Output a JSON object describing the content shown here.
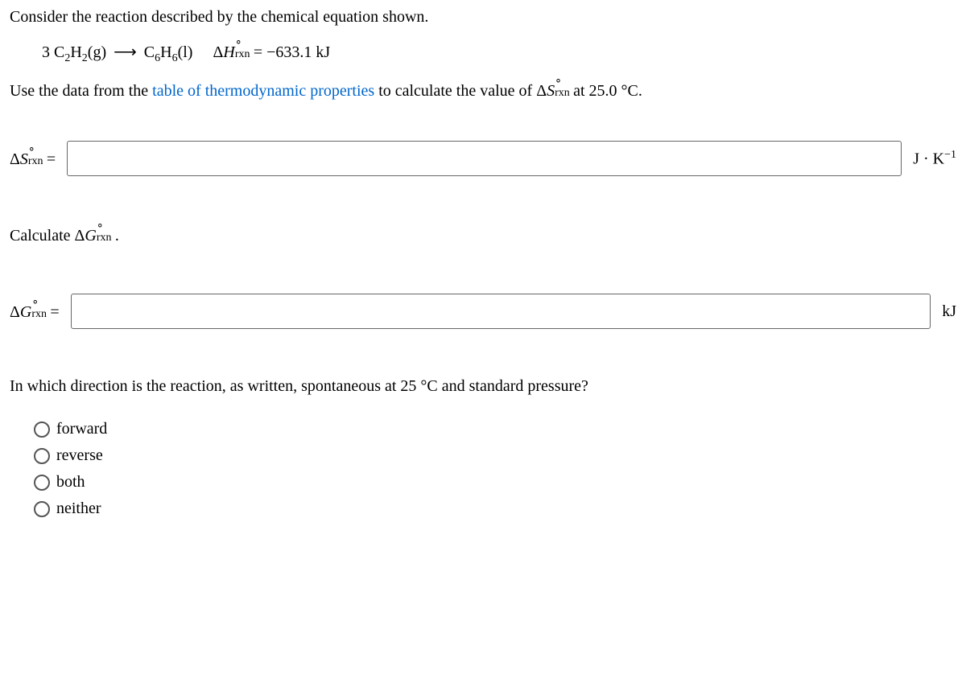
{
  "intro": "Consider the reaction described by the chemical equation shown.",
  "equation": {
    "reactant_coef": "3",
    "reactant": "C₂H₂(g)",
    "arrow": "⟶",
    "product": "C₆H₆(l)",
    "delta_h_symbol_prefix": "Δ",
    "delta_h_var": "H",
    "delta_h_super": "∘",
    "delta_h_sub": "rxn",
    "equals": " = ",
    "delta_h_value": "−633.1 kJ"
  },
  "instruction_pre": "Use the data from the ",
  "instruction_link": "table of thermodynamic properties",
  "instruction_post": " to calculate the value of Δ",
  "instruction_var": "S",
  "instruction_super": "∘",
  "instruction_sub": "rxn",
  "instruction_tail": " at 25.0 °C.",
  "input1": {
    "label_prefix": "Δ",
    "label_var": "S",
    "label_super": "∘",
    "label_sub": "rxn",
    "label_eq": " =",
    "unit": "J · K⁻¹"
  },
  "sub_q": {
    "pre": "Calculate Δ",
    "var": "G",
    "super": "∘",
    "sub": "rxn",
    "post": " ."
  },
  "input2": {
    "label_prefix": "Δ",
    "label_var": "G",
    "label_super": "∘",
    "label_sub": "rxn",
    "label_eq": " =",
    "unit": "kJ"
  },
  "direction_q": "In which direction is the reaction, as written, spontaneous at 25 °C and standard pressure?",
  "options": {
    "o1": "forward",
    "o2": "reverse",
    "o3": "both",
    "o4": "neither"
  }
}
